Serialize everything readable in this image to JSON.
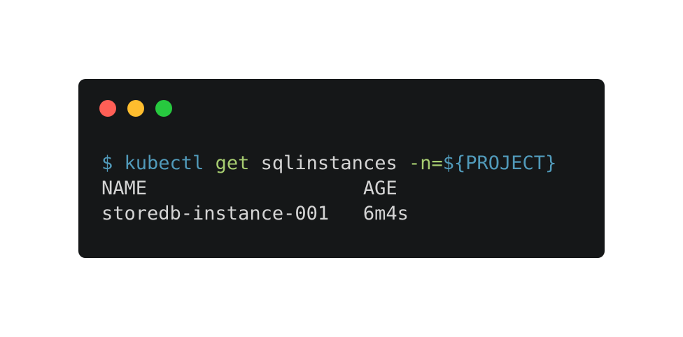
{
  "colors": {
    "background": "#ffffff",
    "terminal_bg": "#151718",
    "dot_red": "#ff5f56",
    "dot_yellow": "#ffbd2e",
    "dot_green": "#27c93f",
    "prompt_blue": "#519aba",
    "keyword_green": "#a6cc70",
    "text": "#d4d4d4"
  },
  "terminal": {
    "command": {
      "prompt": "$",
      "cmd": "kubectl",
      "subcommand": "get",
      "resource": "sqlinstances",
      "flag": "-n=",
      "variable": "${PROJECT}"
    },
    "output": {
      "header": {
        "name": "NAME",
        "age": "AGE"
      },
      "rows": [
        {
          "name": "storedb-instance-001",
          "age": "6m4s"
        }
      ]
    }
  }
}
